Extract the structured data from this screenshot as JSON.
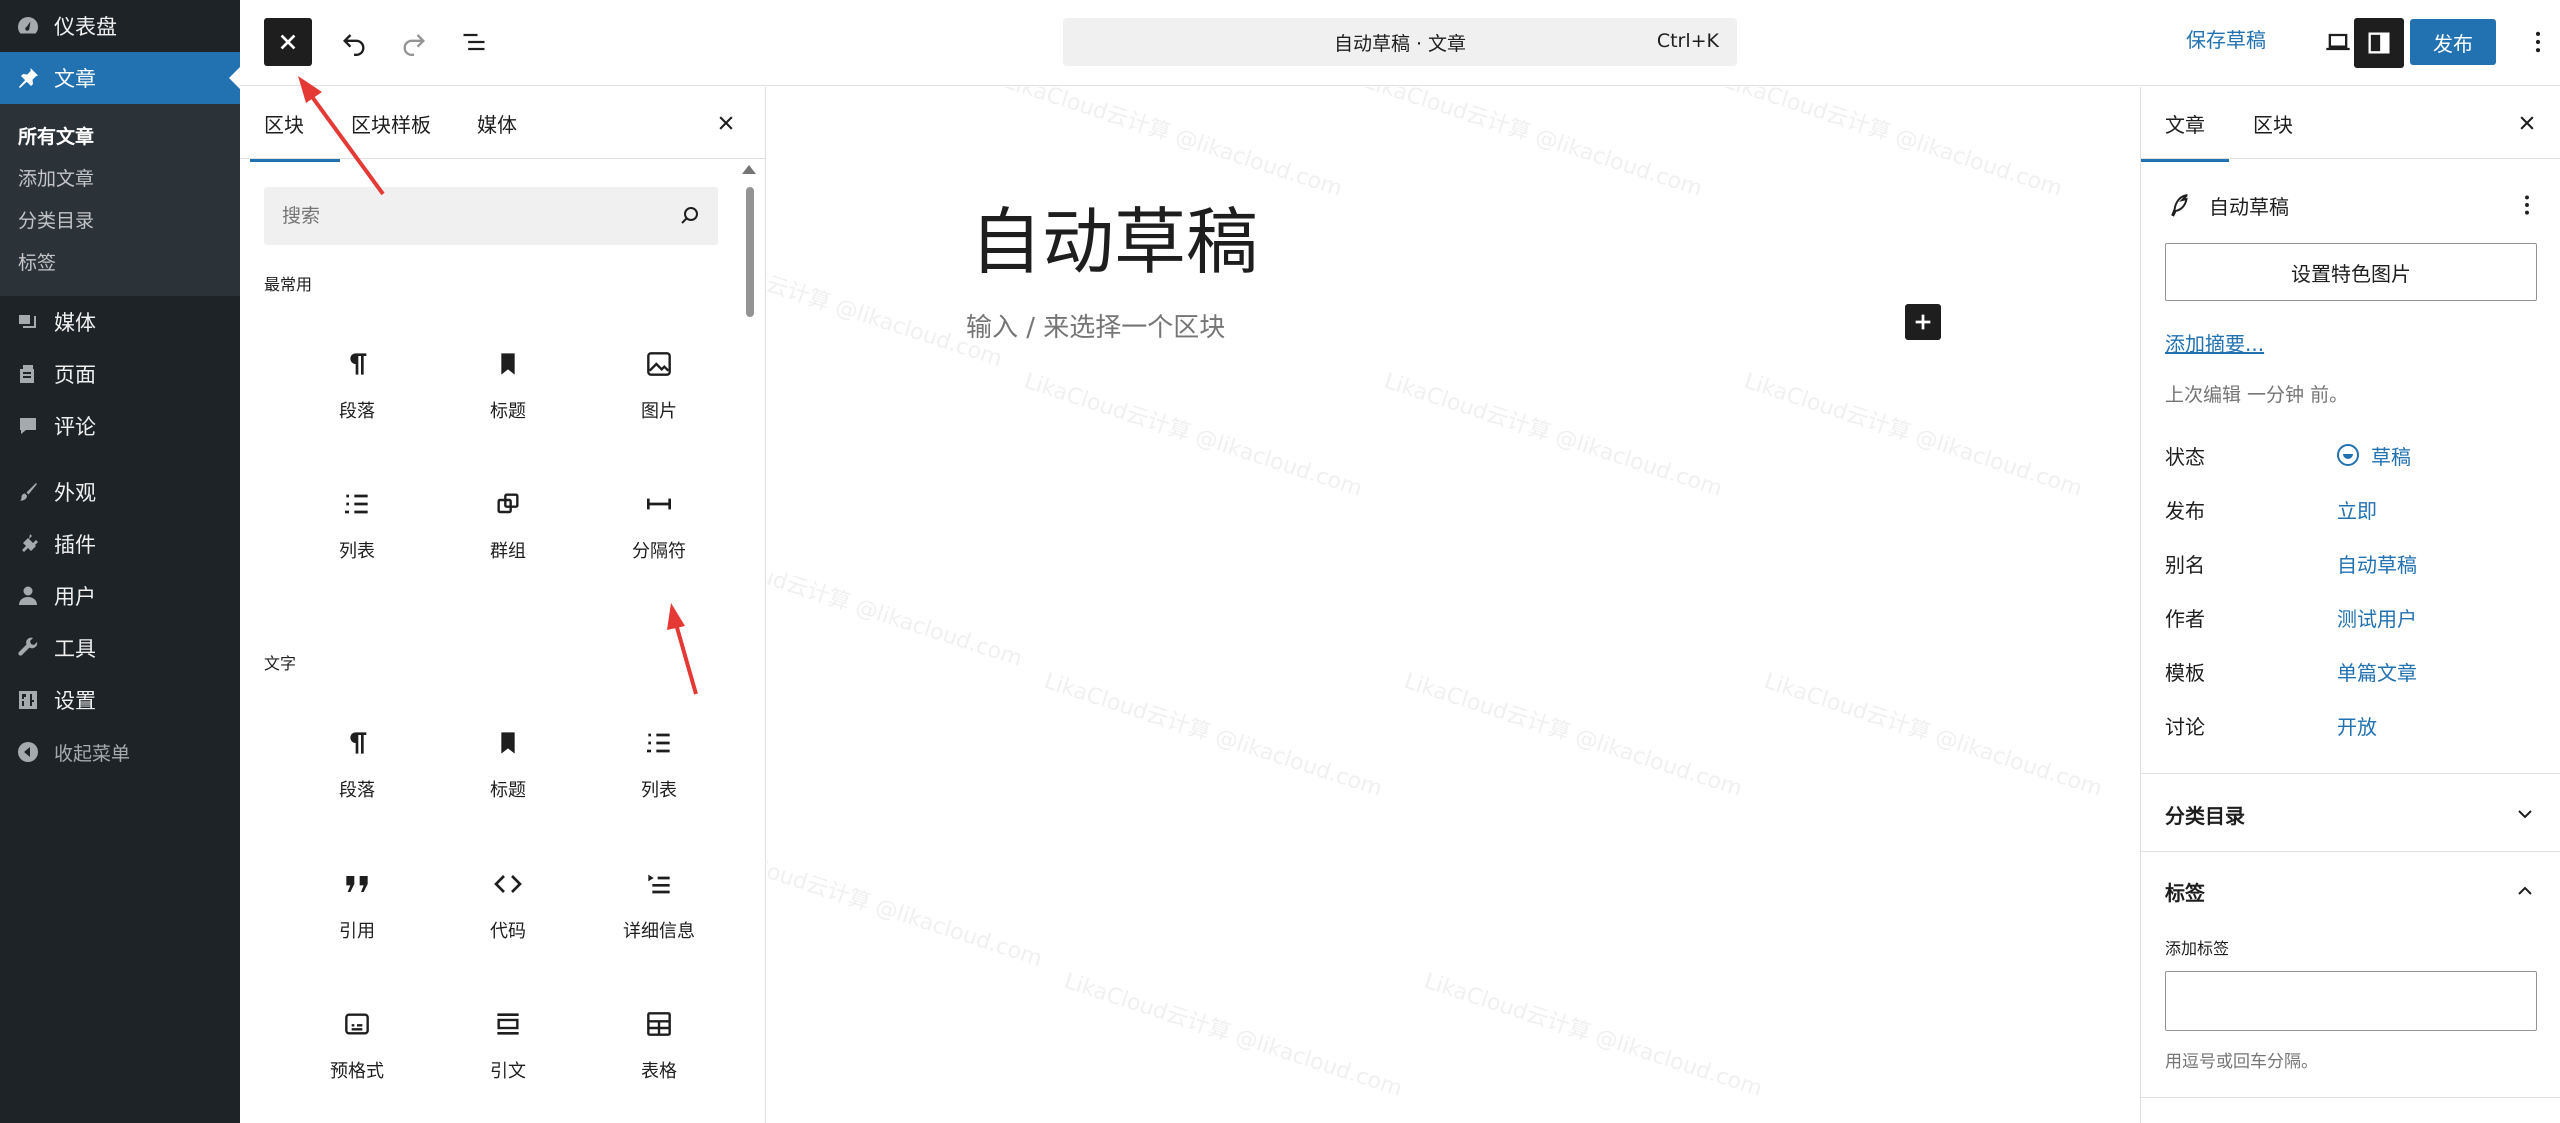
{
  "admin_menu": {
    "items": [
      {
        "label": "仪表盘",
        "icon": "dashboard-icon"
      },
      {
        "label": "文章",
        "icon": "pin-icon"
      },
      {
        "label": "媒体",
        "icon": "media-icon"
      },
      {
        "label": "页面",
        "icon": "page-icon"
      },
      {
        "label": "评论",
        "icon": "comment-icon"
      },
      {
        "label": "外观",
        "icon": "brush-icon"
      },
      {
        "label": "插件",
        "icon": "plugin-icon"
      },
      {
        "label": "用户",
        "icon": "user-icon"
      },
      {
        "label": "工具",
        "icon": "wrench-icon"
      },
      {
        "label": "设置",
        "icon": "settings-icon"
      }
    ],
    "posts_sub": [
      "所有文章",
      "添加文章",
      "分类目录",
      "标签"
    ],
    "collapse_label": "收起菜单"
  },
  "topbar": {
    "command_title": "自动草稿 · 文章",
    "command_shortcut": "Ctrl+K",
    "save_draft": "保存草稿",
    "publish": "发布"
  },
  "inserter": {
    "tabs": [
      "区块",
      "区块样板",
      "媒体"
    ],
    "search_placeholder": "搜索",
    "categories": {
      "common": {
        "label": "最常用",
        "blocks": [
          {
            "label": "段落",
            "icon": "paragraph-icon"
          },
          {
            "label": "标题",
            "icon": "heading-bookmark-icon"
          },
          {
            "label": "图片",
            "icon": "image-icon"
          },
          {
            "label": "列表",
            "icon": "list-icon"
          },
          {
            "label": "群组",
            "icon": "group-icon"
          },
          {
            "label": "分隔符",
            "icon": "separator-icon"
          }
        ]
      },
      "text": {
        "label": "文字",
        "blocks": [
          {
            "label": "段落",
            "icon": "paragraph-icon"
          },
          {
            "label": "标题",
            "icon": "heading-bookmark-icon"
          },
          {
            "label": "列表",
            "icon": "list-icon"
          },
          {
            "label": "引用",
            "icon": "quote-icon"
          },
          {
            "label": "代码",
            "icon": "code-icon"
          },
          {
            "label": "详细信息",
            "icon": "details-icon"
          },
          {
            "label": "预格式",
            "icon": "preformatted-icon"
          },
          {
            "label": "引文",
            "icon": "pullquote-icon"
          },
          {
            "label": "表格",
            "icon": "table-icon"
          }
        ]
      }
    }
  },
  "canvas": {
    "title": "自动草稿",
    "placeholder": "输入 / 来选择一个区块",
    "watermark": "LikaCloud云计算 @likacloud.com"
  },
  "settings": {
    "tabs": [
      "文章",
      "区块"
    ],
    "doc_title": "自动草稿",
    "featured_image": "设置特色图片",
    "add_excerpt": "添加摘要...",
    "last_edited": "上次编辑 一分钟 前。",
    "props": [
      {
        "key": "状态",
        "value": "草稿"
      },
      {
        "key": "发布",
        "value": "立即"
      },
      {
        "key": "别名",
        "value": "自动草稿"
      },
      {
        "key": "作者",
        "value": "测试用户"
      },
      {
        "key": "模板",
        "value": "单篇文章"
      },
      {
        "key": "讨论",
        "value": "开放"
      }
    ],
    "categories_panel": "分类目录",
    "tags_panel": "标签",
    "add_tag_label": "添加标签",
    "tag_help": "用逗号或回车分隔。"
  },
  "colors": {
    "admin_bg": "#1d2327",
    "accent": "#2271b1",
    "annotation": "#e53935"
  }
}
